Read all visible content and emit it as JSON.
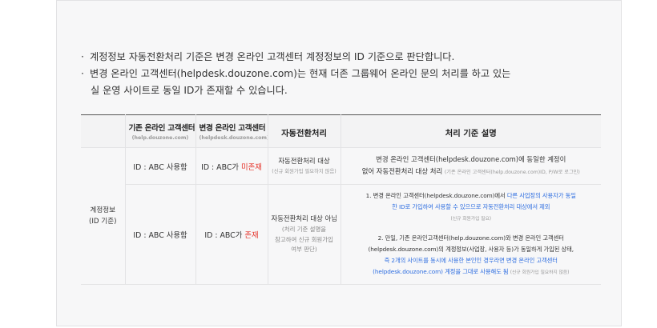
{
  "notes": [
    {
      "bullet": "·",
      "text": "계정정보 자동전환처리 기준은 변경 온라인 고객센터 계정정보의 ID 기준으로 판단합니다."
    },
    {
      "bullet": "·",
      "text": "변경 온라인 고객센터(helpdesk.douzone.com)는 현재 더존 그룹웨어 온라인 문의 처리를 하고 있는",
      "cont": "실 운영 사이트로 동일 ID가 존재할 수 있습니다."
    }
  ],
  "table": {
    "headers": {
      "old": {
        "title": "기존 온라인 고객센터",
        "sub": "(help.douzone.com)"
      },
      "new": {
        "title": "변경 온라인 고객센터",
        "sub": "(helpdesk.douzone.com)"
      },
      "proc": "자동전환처리",
      "desc": "처리 기준 설명"
    },
    "row_label": {
      "line1": "계정정보",
      "line2": "(ID 기준)"
    },
    "row1": {
      "old": "ID : ABC 사용함",
      "new_prefix": "ID : ABC가 ",
      "new_status": "미존재",
      "proc_main": "자동전환처리 대상",
      "proc_sub": "(신규 회원가입 필요하지 않음)",
      "desc_line1": "변경 온라인 고객센터(helpdesk.douzone.com)에 동일한 계정이",
      "desc_line2": "없어 자동전환처리 대상 처리",
      "desc_line2_small": "(기존 온라인 고객센터(help.douzone.com)ID, P/W로 로그인)"
    },
    "row2": {
      "old": "ID : ABC 사용함",
      "new_prefix": "ID : ABC가 ",
      "new_status": "존재",
      "proc_main": "자동전환처리 대상 아님",
      "proc_sub1": "(처리 기준 설명을",
      "proc_sub2": "참고하여 신규 회원가입",
      "proc_sub3": "여부 판단)",
      "desc1_a": "1. 변경 온라인 고객센터(helpdesk.douzone.com)에서 ",
      "desc1_b": "다른 사업장의 사용자가 동일",
      "desc1_c": "한 ID로 가입하여 사용할 수 있으므로 자동전환처리 대상에서 제외",
      "desc1_small": "(신규 회원가입 필요)",
      "desc2_l1": "2. 만일, 기존 온라인고객센터(help.douzone.com)와 변경 온라인 고객센터",
      "desc2_l2": "(helpdesk.douzone.com)의 계정정보(사업장, 사용자 등)가 동일하게 가입된 상태,",
      "desc2_l3": "즉 2개의 사이트를 동시에 사용한 본인인 경우라면 변경 온라인 고객센터",
      "desc2_l4": "(helpdesk.douzone.com) 계정을 그대로 사용해도 됨",
      "desc2_small": "(신규 회원가입 필요하지 않음)"
    }
  },
  "colors": {
    "accent_red": "#e5332a",
    "link_blue": "#2d6de0",
    "panel_bg": "#f7f7f8"
  }
}
